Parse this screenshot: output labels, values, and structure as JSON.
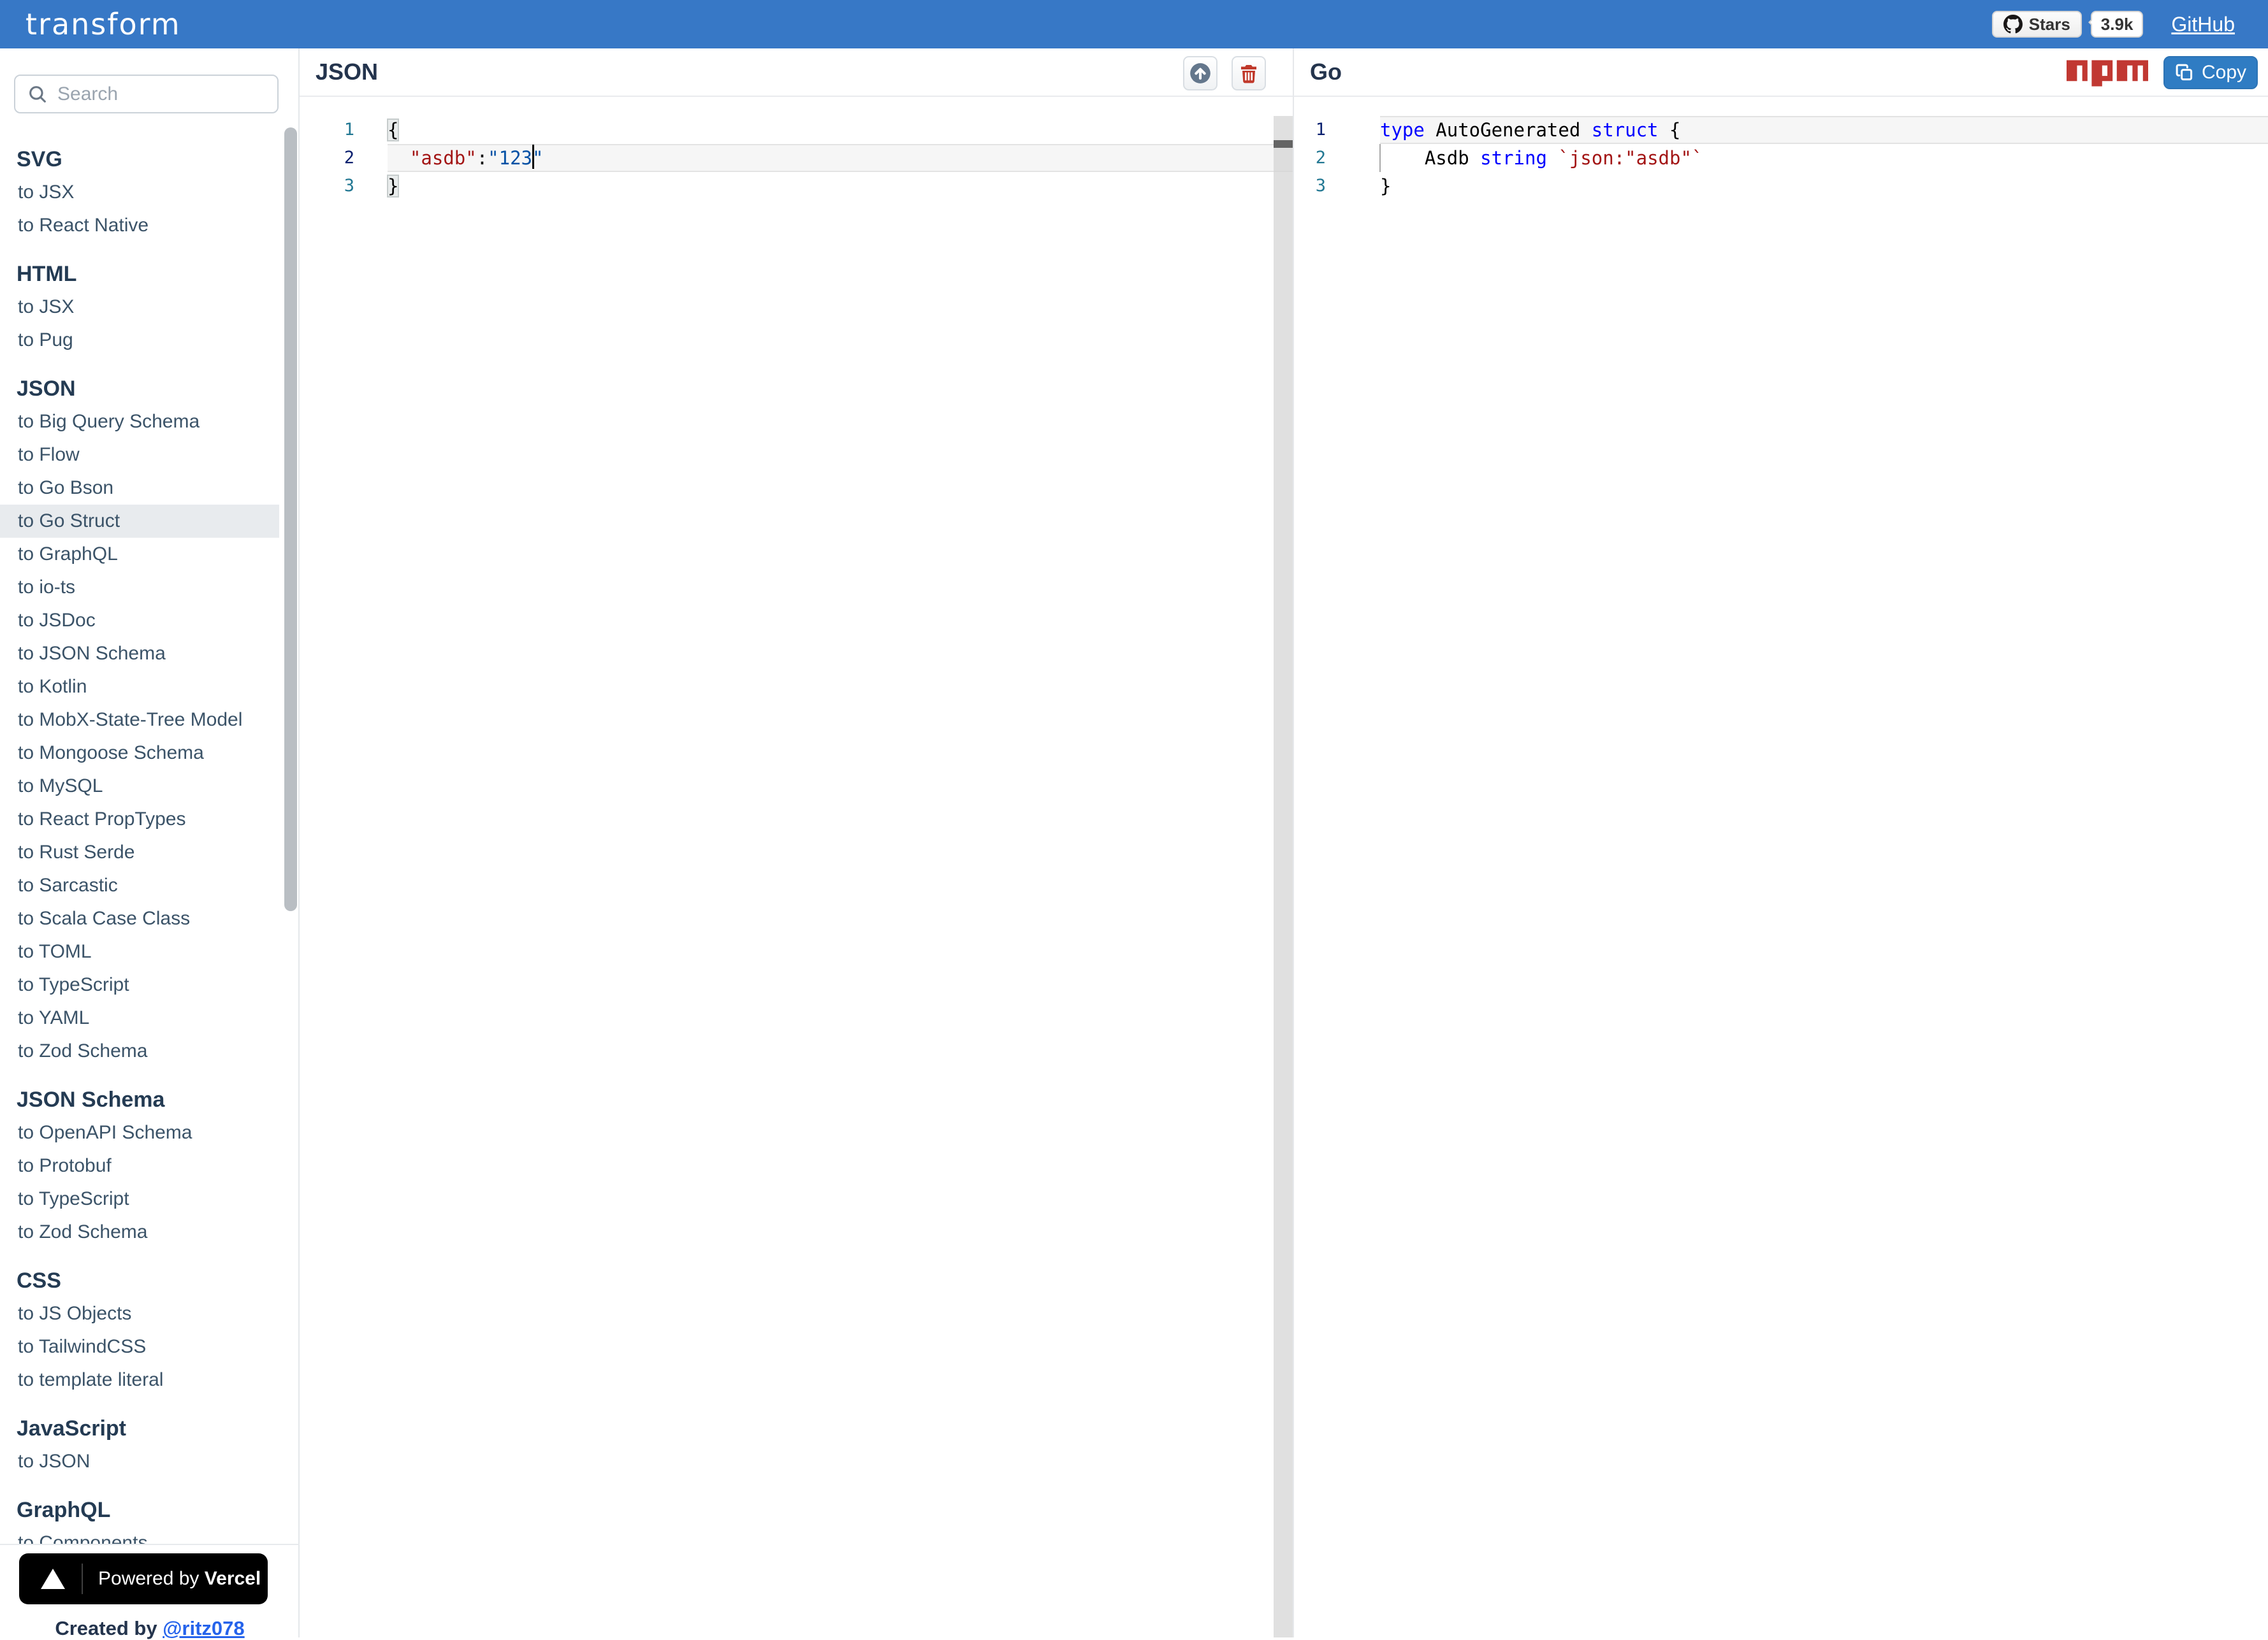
{
  "header": {
    "logo": "transform",
    "stars_label": "Stars",
    "stars_count": "3.9k",
    "github_link": "GitHub"
  },
  "sidebar": {
    "search_placeholder": "Search",
    "sections": [
      {
        "title": "SVG",
        "items": [
          "to JSX",
          "to React Native"
        ]
      },
      {
        "title": "HTML",
        "items": [
          "to JSX",
          "to Pug"
        ]
      },
      {
        "title": "JSON",
        "selected_index": 3,
        "items": [
          "to Big Query Schema",
          "to Flow",
          "to Go Bson",
          "to Go Struct",
          "to GraphQL",
          "to io-ts",
          "to JSDoc",
          "to JSON Schema",
          "to Kotlin",
          "to MobX-State-Tree Model",
          "to Mongoose Schema",
          "to MySQL",
          "to React PropTypes",
          "to Rust Serde",
          "to Sarcastic",
          "to Scala Case Class",
          "to TOML",
          "to TypeScript",
          "to YAML",
          "to Zod Schema"
        ]
      },
      {
        "title": "JSON Schema",
        "items": [
          "to OpenAPI Schema",
          "to Protobuf",
          "to TypeScript",
          "to Zod Schema"
        ]
      },
      {
        "title": "CSS",
        "items": [
          "to JS Objects",
          "to TailwindCSS",
          "to template literal"
        ]
      },
      {
        "title": "JavaScript",
        "items": [
          "to JSON"
        ]
      },
      {
        "title": "GraphQL",
        "items": [
          "to Components"
        ]
      }
    ],
    "footer": {
      "powered_by": "Powered by",
      "vercel": "Vercel",
      "created_by": "Created by",
      "author": "@ritz078"
    }
  },
  "left_panel": {
    "title": "JSON",
    "line_numbers": [
      "1",
      "2",
      "3"
    ],
    "active_line": 2,
    "lines": [
      [
        {
          "t": "{",
          "c": "bracket"
        }
      ],
      [
        {
          "t": "  ",
          "c": "plain"
        },
        {
          "t": "\"asdb\"",
          "c": "key"
        },
        {
          "t": ":",
          "c": "plain"
        },
        {
          "t": "\"123",
          "c": "str"
        },
        {
          "t": "",
          "c": "cursor"
        },
        {
          "t": "\"",
          "c": "str"
        }
      ],
      [
        {
          "t": "}",
          "c": "bracket"
        }
      ]
    ]
  },
  "right_panel": {
    "title": "Go",
    "copy_label": "Copy",
    "line_numbers": [
      "1",
      "2",
      "3"
    ],
    "active_line": 1,
    "lines": [
      [
        {
          "t": "type",
          "c": "kw"
        },
        {
          "t": " AutoGenerated ",
          "c": "plain"
        },
        {
          "t": "struct",
          "c": "kw"
        },
        {
          "t": " {",
          "c": "plain"
        }
      ],
      [
        {
          "t": "    ",
          "c": "plain"
        },
        {
          "t": "Asdb ",
          "c": "plain"
        },
        {
          "t": "string",
          "c": "kw"
        },
        {
          "t": " ",
          "c": "plain"
        },
        {
          "t": "`json:\"asdb\"`",
          "c": "tag"
        }
      ],
      [
        {
          "t": "}",
          "c": "plain"
        }
      ]
    ]
  },
  "colors": {
    "header_blue": "#3778C6",
    "copy_button_blue": "#2F7CC3",
    "npm_red": "#C13832",
    "trash_red": "#C0392B",
    "upload_slate": "#64778C",
    "keyword_blue": "#0000FF",
    "json_key_red": "#A31515",
    "json_value_blue": "#0451A5",
    "line_number_teal": "#237893",
    "line_number_active": "#0B216F"
  },
  "icons": {
    "search": "magnifier",
    "upload": "arrow-up-circle",
    "delete": "trash",
    "copy": "copy-squares",
    "github": "octocat",
    "vercel": "triangle",
    "npm": "npm-wordmark"
  }
}
